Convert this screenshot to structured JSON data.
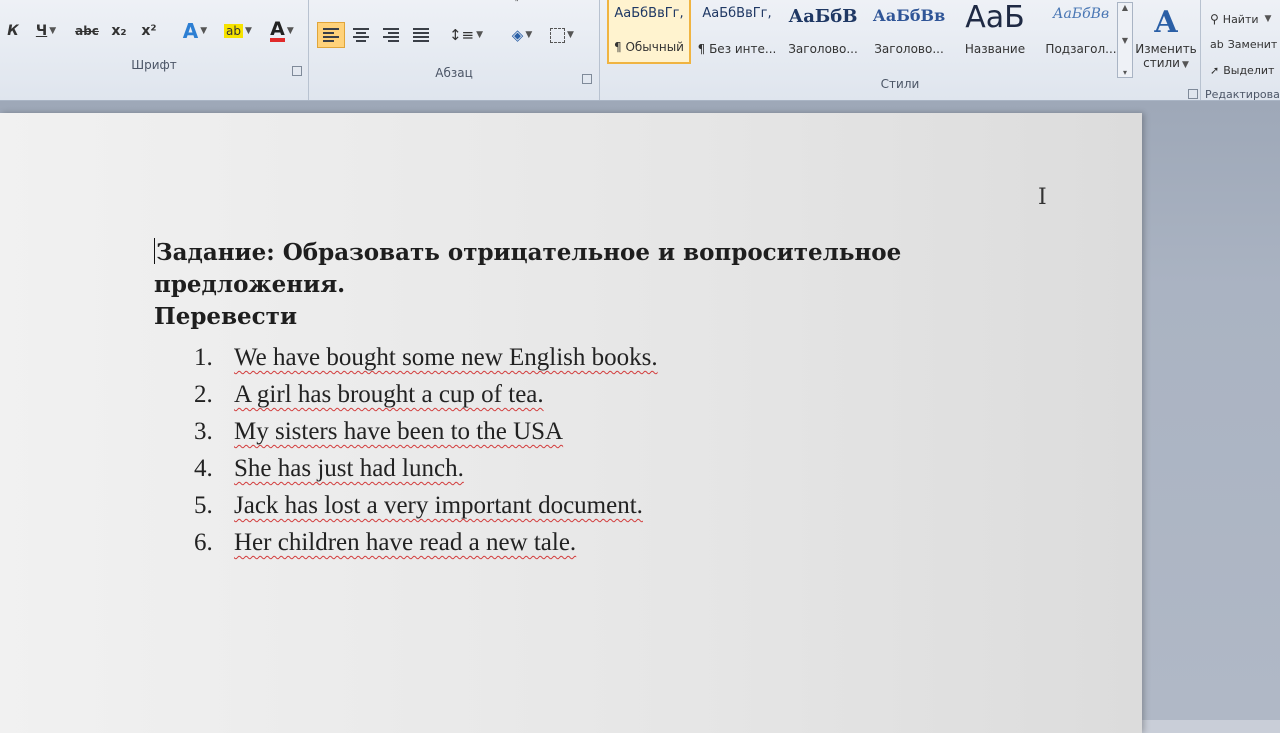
{
  "ribbon": {
    "font_group": {
      "label": "Шрифт",
      "italic": "К",
      "underline": "Ч",
      "strikethrough": "abc",
      "subscript": "x₂",
      "superscript": "x²",
      "text_effects": "A",
      "highlight": "ab",
      "font_color": "A"
    },
    "paragraph_group": {
      "label": "Абзац"
    },
    "styles_group": {
      "label": "Стили",
      "tiles": [
        {
          "sample": "АаБбВвГг,",
          "name": "¶ Обычный"
        },
        {
          "sample": "АаБбВвГг,",
          "name": "¶ Без инте..."
        },
        {
          "sample": "АаБбВ",
          "name": "Заголово..."
        },
        {
          "sample": "АаБбВв",
          "name": "Заголово..."
        },
        {
          "sample": "АаБ",
          "name": "Название"
        },
        {
          "sample": "АаБбВв",
          "name": "Подзагол..."
        }
      ],
      "change_styles_line1": "Изменить",
      "change_styles_line2": "стили"
    },
    "editing_group": {
      "label": "Редактирован",
      "find": "Найти",
      "replace": "Заменит",
      "select": "Выделит"
    }
  },
  "document": {
    "heading_line1": "Задание: Образовать отрицательное и вопросительное предложения.",
    "heading_line2": "Перевести",
    "items": [
      {
        "num": "1.",
        "text": "We have bought some new English books."
      },
      {
        "num": "2.",
        "text": "A girl has brought a cup of tea."
      },
      {
        "num": "3.",
        "text": "My sisters have been to the USA"
      },
      {
        "num": "4.",
        "text": "She has just had lunch."
      },
      {
        "num": "5.",
        "text": "Jack has lost a very important document."
      },
      {
        "num": "6.",
        "text": "Her children have read a new tale."
      }
    ]
  },
  "colors": {
    "accent_active": "#ffd27a",
    "spellcheck_underline": "#d23b3b",
    "style_text": "#1f3864"
  }
}
